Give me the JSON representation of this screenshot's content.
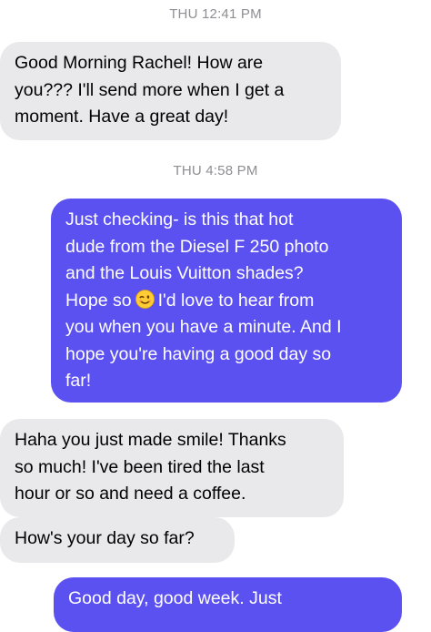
{
  "timestamps": {
    "first": "THU 12:41 PM",
    "second": "THU 4:58 PM"
  },
  "messages": [
    {
      "direction": "incoming",
      "lines": [
        "Good Morning Rachel! How are",
        "you??? I'll send more when I get a",
        "moment. Have a great day!"
      ]
    },
    {
      "direction": "outgoing",
      "lines": [
        "Just checking- is this that hot",
        "dude from the Diesel F 250 photo",
        "and the Louis Vuitton shades?",
        "Hope so",
        "I'd love to hear from",
        "you when you have a minute. And I",
        "hope you're having a good day so",
        "far!"
      ],
      "emoji": "winking-face-emoji"
    },
    {
      "direction": "incoming",
      "lines": [
        "Haha you just made smile! Thanks",
        "so much! I've been tired the last",
        "hour or so and need a coffee."
      ]
    },
    {
      "direction": "incoming",
      "lines": [
        "How's your day so far?"
      ]
    },
    {
      "direction": "outgoing",
      "lines": [
        "Good day, good week. Just"
      ]
    }
  ],
  "colors": {
    "outgoing_bubble": "#5b50f0",
    "incoming_bubble": "#e9e9eb",
    "timestamp_text": "#8e8e93"
  }
}
